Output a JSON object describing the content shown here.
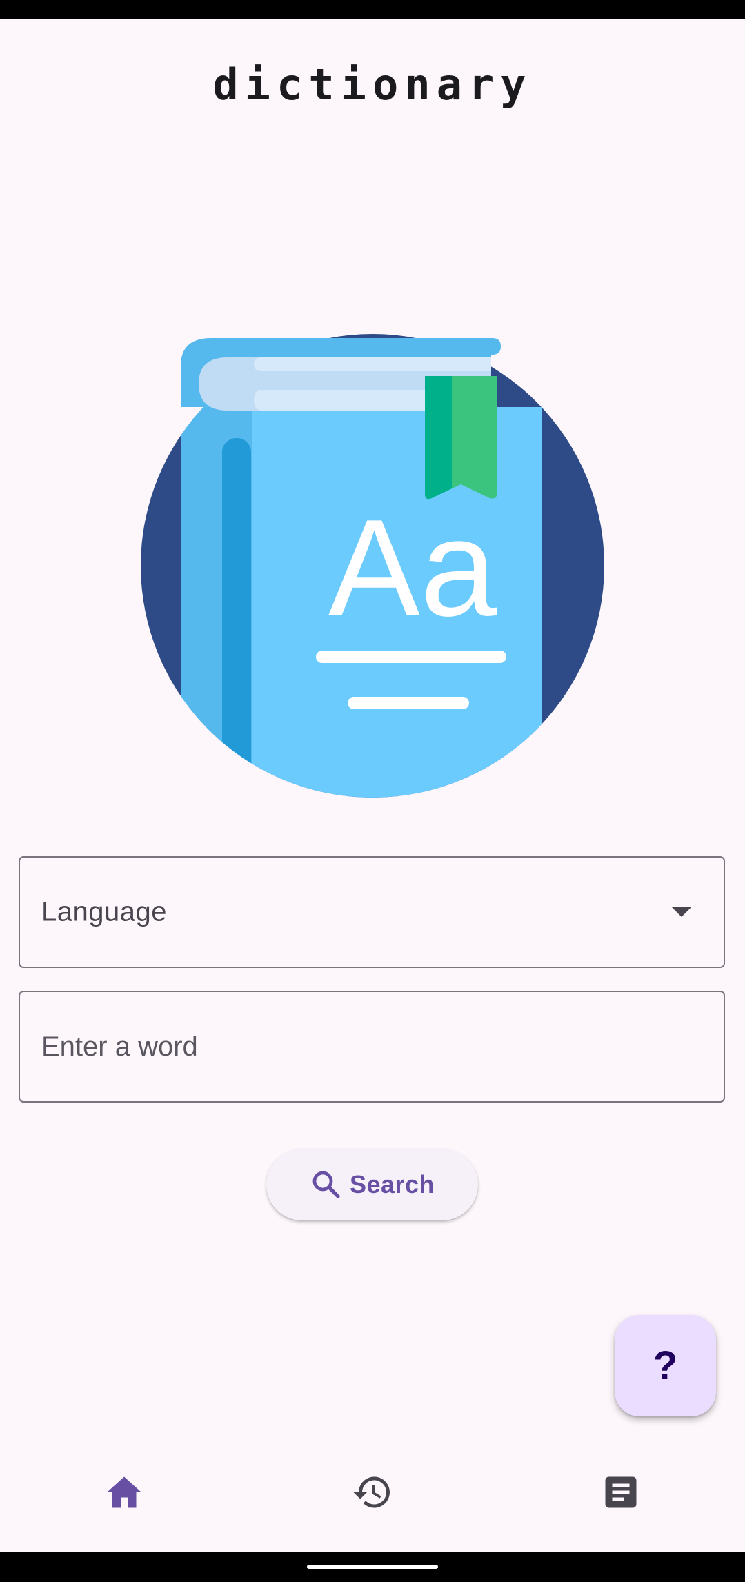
{
  "app": {
    "title": "dictionary"
  },
  "form": {
    "language_label": "Language",
    "word_placeholder": "Enter a word",
    "word_value": ""
  },
  "actions": {
    "search_label": "Search",
    "fab_glyph": "?"
  },
  "hero": {
    "book_text": "Aa",
    "icon": "book-icon"
  },
  "bottom_nav": {
    "items": [
      {
        "icon": "home-icon",
        "active": true
      },
      {
        "icon": "history-icon",
        "active": false
      },
      {
        "icon": "notes-icon",
        "active": false
      }
    ]
  },
  "colors": {
    "background": "#fdf7fb",
    "accent": "#6750a4",
    "fab_background": "#eaddff",
    "circle": "#2e4b87",
    "book_cover": "#6bcbfd",
    "book_spine": "#55b9ee",
    "bookmark": "#3bc47e"
  }
}
